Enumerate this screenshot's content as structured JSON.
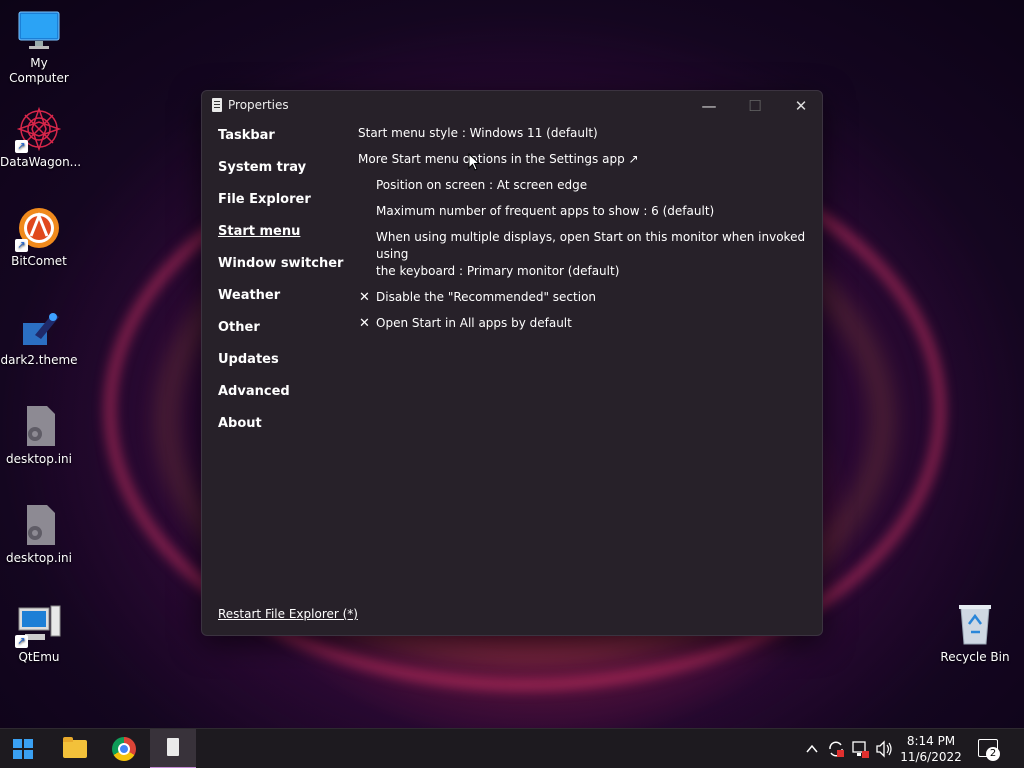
{
  "desktop": {
    "icons": [
      {
        "label": "My Computer",
        "icon": "monitor-icon"
      },
      {
        "label": "DataWagon...",
        "icon": "mandala-icon"
      },
      {
        "label": "BitComet",
        "icon": "bitcomet-icon"
      },
      {
        "label": "dark2.theme",
        "icon": "theme-file-icon"
      },
      {
        "label": "desktop.ini",
        "icon": "settings-file-icon"
      },
      {
        "label": "desktop.ini",
        "icon": "settings-file-icon"
      },
      {
        "label": "QtEmu",
        "icon": "qtemu-icon"
      },
      {
        "label": "Recycle Bin",
        "icon": "recycle-bin-icon"
      }
    ]
  },
  "window": {
    "title": "Properties",
    "controls": {
      "minimize": "—",
      "maximize": "☐",
      "close": "✕"
    },
    "nav": [
      {
        "label": "Taskbar"
      },
      {
        "label": "System tray"
      },
      {
        "label": "File Explorer"
      },
      {
        "label": "Start menu"
      },
      {
        "label": "Window switcher"
      },
      {
        "label": "Weather"
      },
      {
        "label": "Other"
      },
      {
        "label": "Updates"
      },
      {
        "label": "Advanced"
      },
      {
        "label": "About"
      }
    ],
    "active_nav": "Start menu",
    "settings": {
      "start_menu_style": "Start menu style : Windows 11 (default)",
      "more_options": "More Start menu options in the Settings app ↗",
      "position": "Position on screen : At screen edge",
      "max_frequent": "Maximum number of frequent apps to show : 6 (default)",
      "multi_display_line1": "When using multiple displays, open Start on this monitor when invoked using",
      "multi_display_line2": "the keyboard : Primary monitor (default)",
      "disable_recommended": "Disable the \"Recommended\" section",
      "open_all_apps": "Open Start in All apps by default",
      "check_mark": "✕"
    },
    "restart_link": "Restart File Explorer (*)"
  },
  "taskbar": {
    "clock_time": "8:14 PM",
    "clock_date": "11/6/2022",
    "notification_count": "2",
    "tray_chevron": "^",
    "volume_glyph": "🔊"
  },
  "colors": {
    "window_bg": "#272129",
    "taskbar_bg": "#1d1a1f",
    "accent_indicator": "#c48bd6"
  }
}
